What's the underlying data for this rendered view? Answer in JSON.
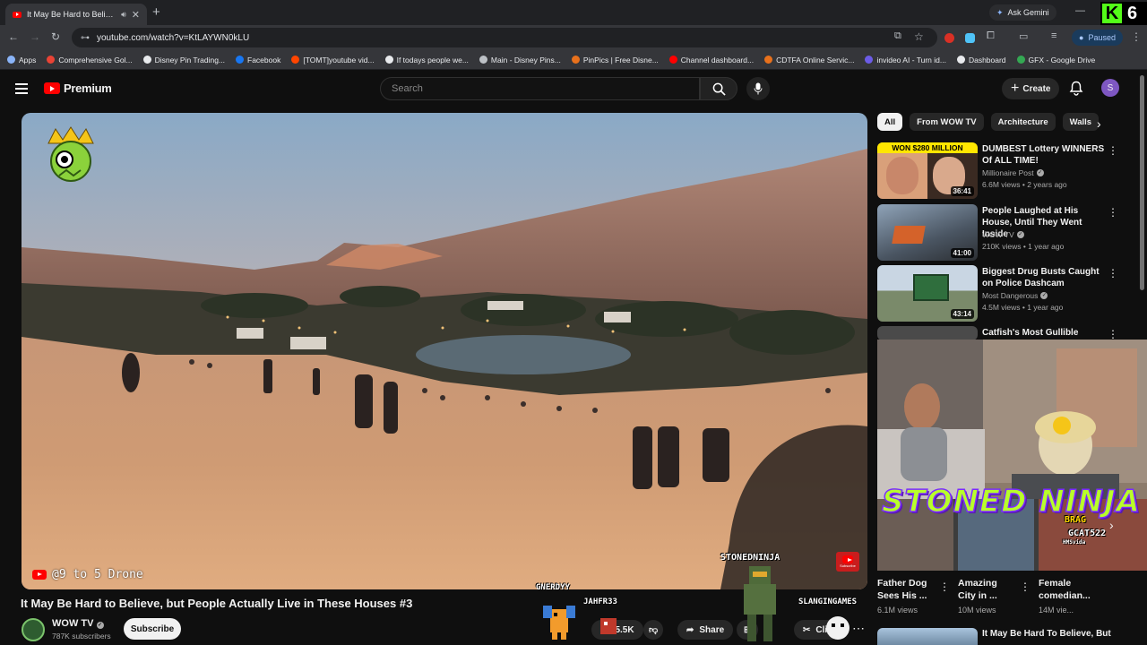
{
  "browser": {
    "tab_title": "It May Be Hard to Believe, but",
    "ask_gemini": "Ask Gemini",
    "url": "youtube.com/watch?v=KtLAYWN0kLU",
    "profile_status": "Paused",
    "kick_count": "6"
  },
  "bookmarks": [
    {
      "label": "Apps",
      "color": "#8ab4f8"
    },
    {
      "label": "Comprehensive Gol...",
      "color": "#ea4335"
    },
    {
      "label": "Disney Pin Trading...",
      "color": "#e8eaed"
    },
    {
      "label": "Facebook",
      "color": "#1877f2"
    },
    {
      "label": "[TOMT]youtube vid...",
      "color": "#ff4500"
    },
    {
      "label": "If todays people we...",
      "color": "#e8eaed"
    },
    {
      "label": "Main - Disney Pins...",
      "color": "#bdc1c6"
    },
    {
      "label": "PinPics | Free Disne...",
      "color": "#e8711c"
    },
    {
      "label": "Channel dashboard...",
      "color": "#ff0000"
    },
    {
      "label": "CDTFA Online Servic...",
      "color": "#e8711c"
    },
    {
      "label": "invideo AI - Turn id...",
      "color": "#6c5ce7"
    },
    {
      "label": "Dashboard",
      "color": "#e8eaed"
    },
    {
      "label": "GFX - Google Drive",
      "color": "#34a853"
    }
  ],
  "youtube": {
    "logo_text": "Premium",
    "search_placeholder": "Search",
    "create_label": "Create",
    "avatar_letter": "S"
  },
  "video": {
    "title": "It May Be Hard to Believe, but People Actually Live in These Houses #3",
    "overlay_channel": "@9 to 5 Drone",
    "channel_name": "WOW TV",
    "subscribers": "787K subscribers",
    "subscribe_label": "Subscribe",
    "likes": "5.5K",
    "share_label": "Share",
    "clip_label": "Clip"
  },
  "stream_overlay": {
    "streamer": "STONEDNINJA",
    "viewer_1": "GNERDYY",
    "viewer_2": "JAHFR33",
    "viewer_3": "SLANGINGAMES",
    "banner": "STONED NINJA",
    "badge": "BRAG",
    "badge_2": "GCAT522",
    "badge_3": "HMSvida"
  },
  "chips": [
    "All",
    "From WOW TV",
    "Architecture",
    "Walls"
  ],
  "recommendations": [
    {
      "title": "DUMBEST Lottery WINNERS Of ALL TIME!",
      "channel": "Millionaire Post",
      "meta": "6.6M views • 2 years ago",
      "duration": "36:41",
      "thumb_caption": "WON $280 MILLION"
    },
    {
      "title": "People Laughed at His House, Until They Went Inside",
      "channel": "WOW TV",
      "meta": "210K views • 1 year ago",
      "duration": "41:00"
    },
    {
      "title": "Biggest Drug Busts Caught on Police Dashcam",
      "channel": "Most Dangerous",
      "meta": "4.5M views • 1 year ago",
      "duration": "43:14"
    },
    {
      "title": "Catfish's Most Gullible Victims"
    }
  ],
  "shorts": [
    {
      "title": "Father Dog Sees His ...",
      "views": "6.1M views"
    },
    {
      "title": "Amazing City in ...",
      "views": "10M views"
    },
    {
      "title": "Female comedian...",
      "views": "14M vie..."
    }
  ],
  "last_rec_title": "It May Be Hard To Believe, But"
}
